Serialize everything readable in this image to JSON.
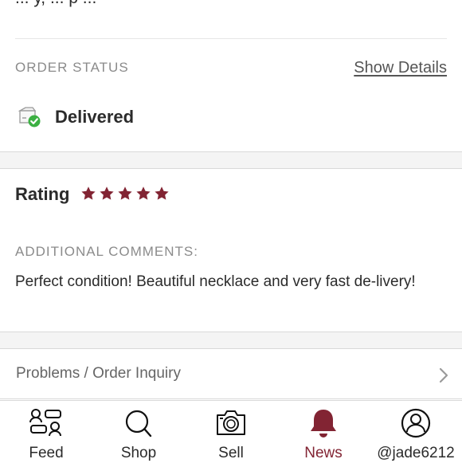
{
  "header": {
    "partial_text": "... y, ... p ..."
  },
  "order_status": {
    "label": "ORDER STATUS",
    "show_details": "Show Details",
    "status": "Delivered"
  },
  "rating": {
    "label": "Rating",
    "stars": 5,
    "star_color": "#822433"
  },
  "comments": {
    "label": "ADDITIONAL COMMENTS:",
    "text": "Perfect condition! Beautiful necklace and very fast de-livery!"
  },
  "inquiry": {
    "label": "Problems / Order Inquiry"
  },
  "tabs": [
    {
      "label": "Feed",
      "icon": "feed-icon"
    },
    {
      "label": "Shop",
      "icon": "search-icon"
    },
    {
      "label": "Sell",
      "icon": "camera-icon"
    },
    {
      "label": "News",
      "icon": "bell-icon",
      "active": true
    },
    {
      "label": "@jade6212",
      "icon": "user-icon"
    }
  ],
  "colors": {
    "accent": "#822433",
    "success": "#3cb043"
  }
}
